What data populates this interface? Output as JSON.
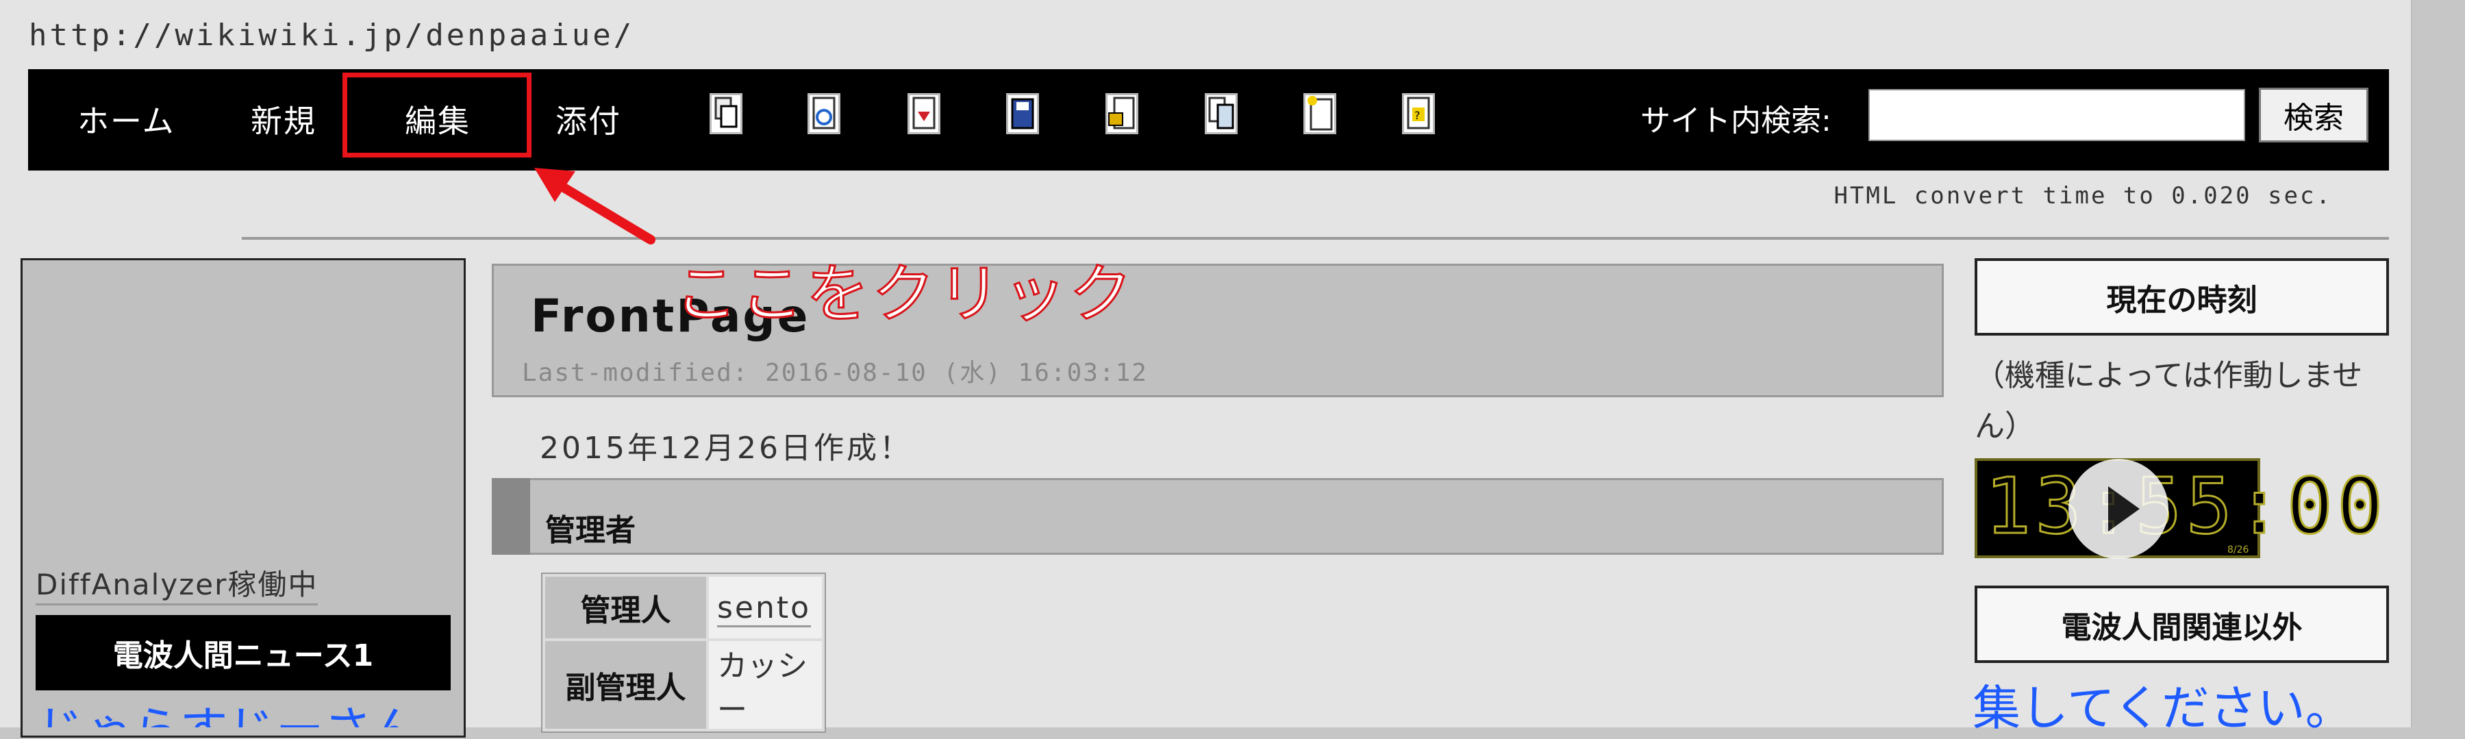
{
  "site": {
    "url": "http://wikiwiki.jp/denpaaiue/"
  },
  "navbar": {
    "items": [
      "ホーム",
      "新規",
      "編集",
      "添付"
    ],
    "tool_icons": [
      "copy-page-icon",
      "reload-icon",
      "download-icon",
      "save-icon",
      "lock-icon",
      "duplicate-icon",
      "new-page-icon",
      "help-icon"
    ],
    "search_label": "サイト内検索:",
    "search_button": "検索",
    "search_placeholder": ""
  },
  "annotation": {
    "text": "ここをクリック",
    "color": "#e8141a"
  },
  "convert_time": "HTML convert time to 0.020 sec.",
  "left_menu": {
    "diff_label": "DiffAnalyzer稼働中",
    "news_title": "電波人間ニュース1",
    "ticker_text": "じゃらすじーさん"
  },
  "main": {
    "title": "FrontPage",
    "last_modified": "Last-modified: 2016-08-10 (水) 16:03:12",
    "created": "2015年12月26日作成！",
    "section_title": "管理者",
    "admin_table": [
      {
        "role": "管理人",
        "name": "sento"
      },
      {
        "role": "副管理人",
        "name": "カッシー"
      }
    ]
  },
  "right_menu": {
    "clock_title": "現在の時刻",
    "clock_note": "（機種によっては作動しません）",
    "clock_digits": "13:55:00",
    "clock_date": "8/26",
    "box2_title": "電波人間関連以外",
    "edit_link": "集してください。"
  }
}
